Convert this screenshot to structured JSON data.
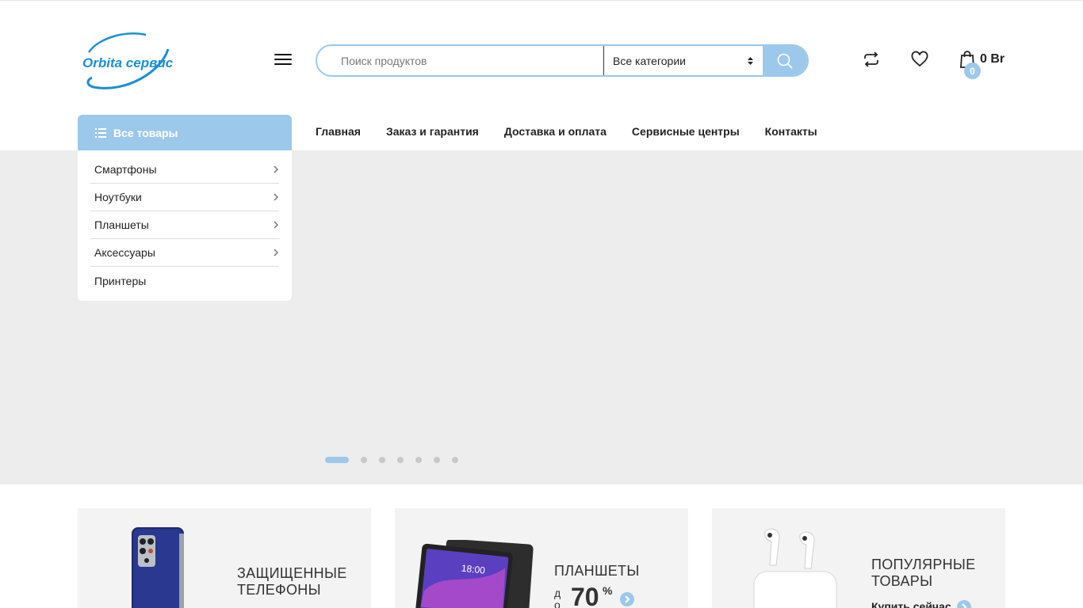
{
  "header": {
    "logo_text": "Orbita сервис",
    "search_placeholder": "Поиск продуктов",
    "category_select": "Все категории",
    "cart_count": "0",
    "cart_total": "0 Br"
  },
  "nav": {
    "all_categories": "Все товары",
    "links": [
      "Главная",
      "Заказ и гарантия",
      "Доставка и оплата",
      "Сервисные центры",
      "Контакты"
    ]
  },
  "catmenu": {
    "items": [
      "Смартфоны",
      "Ноутбуки",
      "Планшеты",
      "Аксессуары",
      "Принтеры"
    ]
  },
  "slider": {
    "slide_count": 7,
    "active_slide": 1
  },
  "banners": [
    {
      "title_line1": "ЗАЩИЩЕННЫЕ",
      "title_line2": "ТЕЛЕФОНЫ"
    },
    {
      "title_line1": "ПЛАНШЕТЫ",
      "prefix": "до",
      "percent": "70",
      "percent_sign": "%"
    },
    {
      "title_line1": "ПОПУЛЯРНЫЕ",
      "title_line2": "ТОВАРЫ",
      "cta": "Купить сейчас"
    }
  ],
  "colors": {
    "accent": "#9cc8ec",
    "logo_blue": "#1a8fd6",
    "slider_bg": "#ededed",
    "banner_bg": "#f3f3f3"
  }
}
